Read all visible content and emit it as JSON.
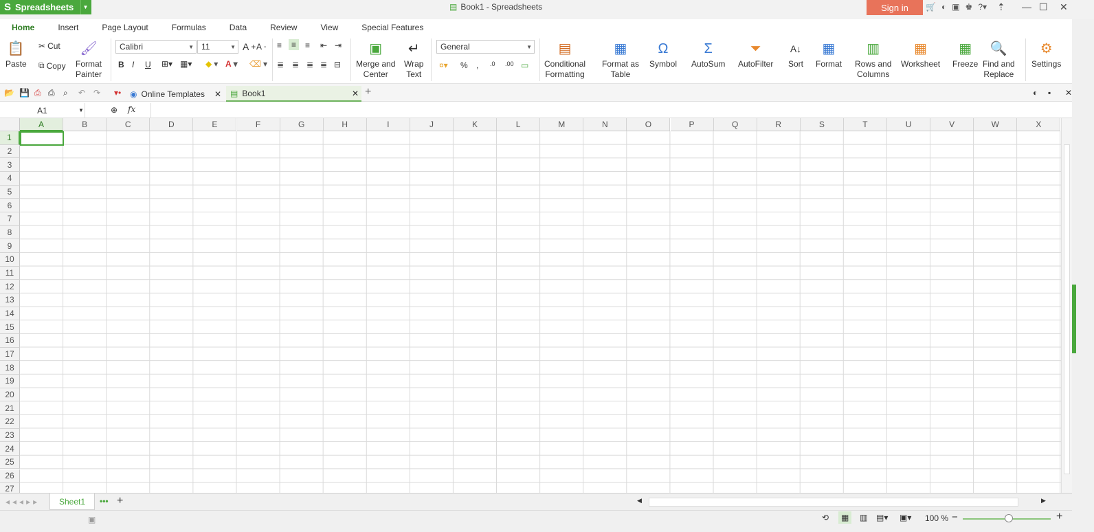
{
  "app": {
    "name": "Spreadsheets",
    "doc_title": "Book1 - Spreadsheets",
    "sign_in": "Sign in",
    "accent": "#4aa83d",
    "signin_color": "#e8735a"
  },
  "menu_tabs": [
    "Home",
    "Insert",
    "Page Layout",
    "Formulas",
    "Data",
    "Review",
    "View",
    "Special Features"
  ],
  "ribbon": {
    "paste": "Paste",
    "cut": "Cut",
    "copy": "Copy",
    "format_painter_1": "Format",
    "format_painter_2": "Painter",
    "font_name": "Calibri",
    "font_size": "11",
    "bold": "B",
    "italic": "I",
    "underline": "U",
    "merge_1": "Merge and",
    "merge_2": "Center",
    "wrap_1": "Wrap",
    "wrap_2": "Text",
    "number_format": "General",
    "cond_1": "Conditional",
    "cond_2": "Formatting",
    "fmt_table_1": "Format as",
    "fmt_table_2": "Table",
    "symbol": "Symbol",
    "autosum": "AutoSum",
    "autofilter": "AutoFilter",
    "sort": "Sort",
    "format": "Format",
    "rows_cols_1": "Rows and",
    "rows_cols_2": "Columns",
    "worksheet": "Worksheet",
    "freeze": "Freeze",
    "find_1": "Find and",
    "find_2": "Replace",
    "settings": "Settings"
  },
  "doc_tabs": {
    "templates": "Online Templates",
    "book": "Book1"
  },
  "formula_bar": {
    "cell_ref": "A1",
    "fx": "fx",
    "value": ""
  },
  "columns": [
    "A",
    "B",
    "C",
    "D",
    "E",
    "F",
    "G",
    "H",
    "I",
    "J",
    "K",
    "L",
    "M",
    "N",
    "O",
    "P",
    "Q",
    "R",
    "S",
    "T",
    "U",
    "V",
    "W",
    "X"
  ],
  "rows": [
    "1",
    "2",
    "3",
    "4",
    "5",
    "6",
    "7",
    "8",
    "9",
    "10",
    "11",
    "12",
    "13",
    "14",
    "15",
    "16",
    "17",
    "18",
    "19",
    "20",
    "21",
    "22",
    "23",
    "24",
    "25",
    "26",
    "27"
  ],
  "sheet": {
    "name": "Sheet1"
  },
  "status": {
    "zoom": "100 %"
  }
}
